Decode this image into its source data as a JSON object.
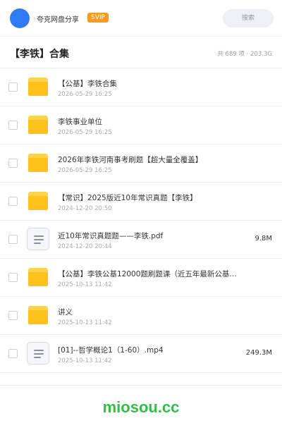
{
  "header": {
    "brand": "夸克网盘分享",
    "badge": "SVIP",
    "search_label": "搜索"
  },
  "folder": {
    "title": "【李铁】合集",
    "summary": "共 689 项 · 203.3G"
  },
  "files": [
    {
      "type": "folder",
      "name": "【公基】李铁合集",
      "date": "2026-05-29 16:25",
      "size": ""
    },
    {
      "type": "folder",
      "name": "李铁事业单位",
      "date": "2026-05-29 16:25",
      "size": ""
    },
    {
      "type": "folder",
      "name": "2026年李铁河南事考刷题【超大量全覆盖】",
      "date": "2026-05-29 16:25",
      "size": ""
    },
    {
      "type": "folder",
      "name": "【常识】2025版近10年常识真题【李铁】",
      "date": "2024-12-20 20:50",
      "size": ""
    },
    {
      "type": "doc",
      "name": "近10年常识真题题——李铁.pdf",
      "date": "2024-12-20 20:44",
      "size": "9.8M"
    },
    {
      "type": "folder",
      "name": "【公基】李铁公基12000题刷题课（近五年最新公基…",
      "date": "2025-10-13 11:42",
      "size": ""
    },
    {
      "type": "folder",
      "name": "讲义",
      "date": "2025-10-13 11:42",
      "size": ""
    },
    {
      "type": "doc",
      "name": "[01]--哲学概论1（1-60）.mp4",
      "date": "2025-10-13 11:42",
      "size": "249.3M"
    }
  ],
  "footer": {
    "watermark": "miosou.cc"
  }
}
